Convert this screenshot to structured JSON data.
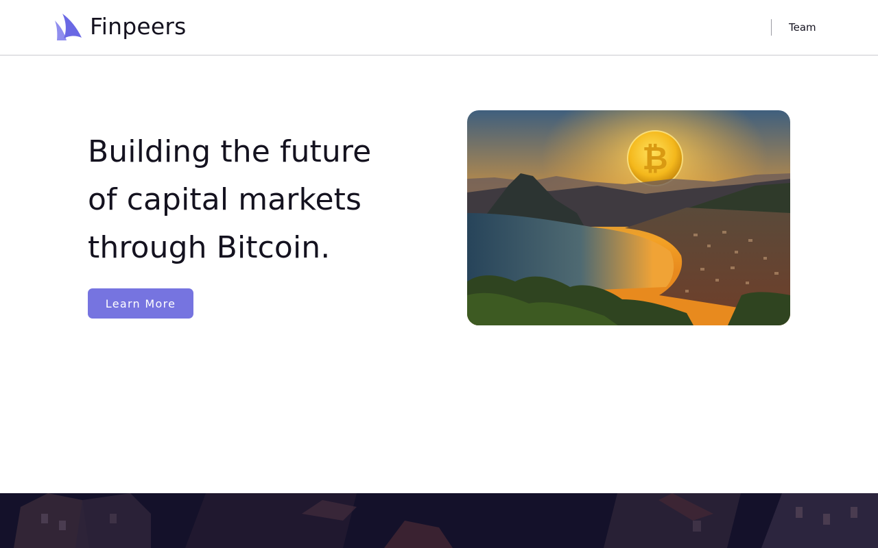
{
  "header": {
    "brand": "Finpeers",
    "logo_icon": "sail-logo-icon",
    "nav": [
      {
        "label": "Team"
      }
    ]
  },
  "hero": {
    "title_lines": [
      "Building the future",
      "of capital markets",
      "through Bitcoin."
    ],
    "cta_label": "Learn More",
    "image_alt": "Sunset over a lake town with a Bitcoin coin as the sun"
  },
  "colors": {
    "accent": "#7674e0",
    "text": "#14121f",
    "footer_background": "#12101f",
    "logo_primary": "#6a68e4",
    "logo_secondary": "#8f8dee"
  }
}
